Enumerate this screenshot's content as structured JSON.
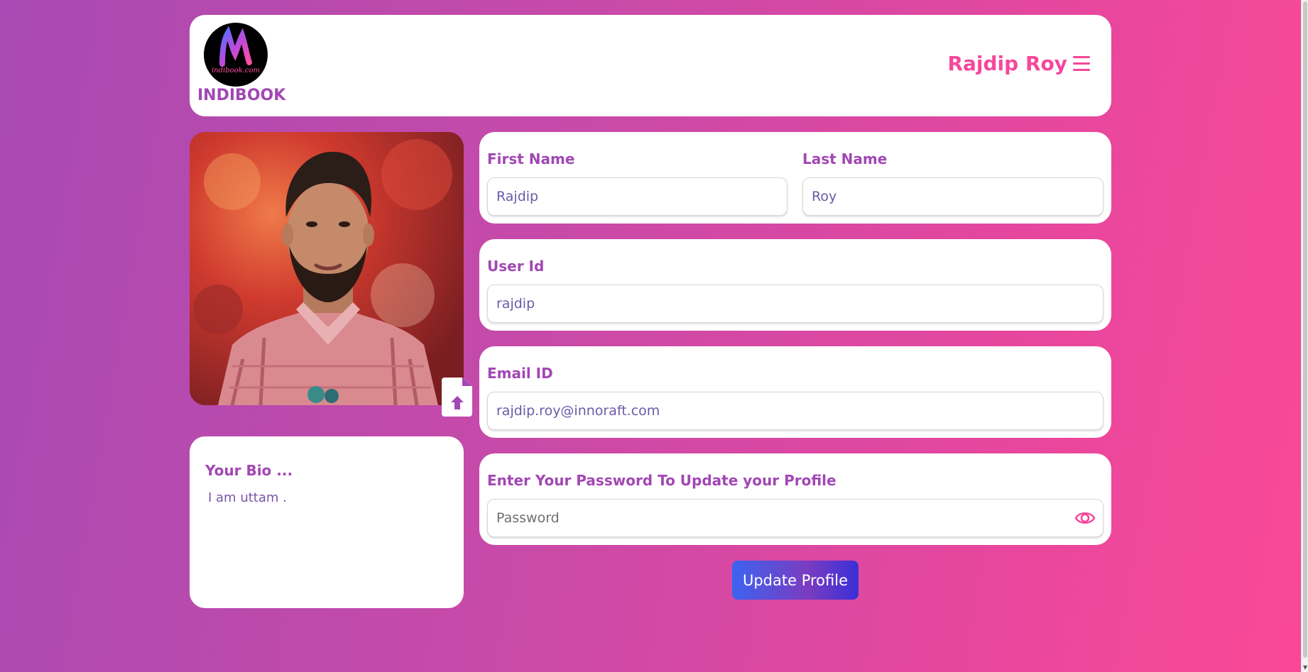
{
  "header": {
    "logo_text": "indibook.com",
    "brand": "INDIBOOK",
    "user_name": "Rajdip Roy"
  },
  "profile": {
    "bio_title": "Your Bio ...",
    "bio_text": "I am uttam ."
  },
  "form": {
    "first_name_label": "First Name",
    "first_name_value": "Rajdip",
    "last_name_label": "Last Name",
    "last_name_value": "Roy",
    "user_id_label": "User Id",
    "user_id_value": "rajdip",
    "email_label": "Email ID",
    "email_value": "rajdip.roy@innoraft.com",
    "password_label": "Enter Your Password To Update your Profile",
    "password_placeholder": "Password",
    "submit_label": "Update Profile"
  },
  "icons": {
    "menu": "hamburger-icon",
    "upload": "upload-file-icon",
    "eye": "eye-icon"
  },
  "colors": {
    "accent_purple": "#a247b4",
    "accent_pink": "#f5479b",
    "button_start": "#3c63f0",
    "button_end": "#3a2fd8"
  }
}
